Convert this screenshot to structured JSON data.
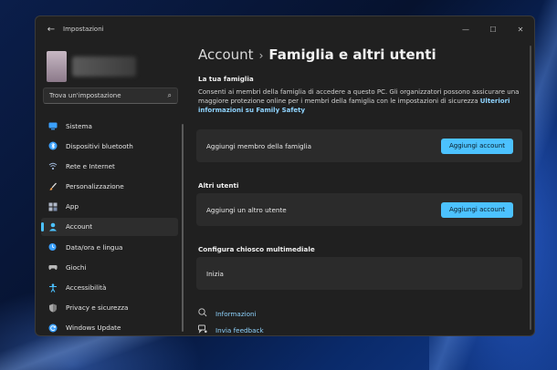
{
  "window": {
    "title": "Impostazioni"
  },
  "search": {
    "placeholder": "Trova un'impostazione"
  },
  "sidebar": {
    "items": [
      {
        "label": "Sistema",
        "icon": "monitor-icon",
        "color": "#3aa0ff"
      },
      {
        "label": "Dispositivi bluetooth",
        "icon": "bluetooth-icon",
        "color": "#3aa0ff"
      },
      {
        "label": "Rete e Internet",
        "icon": "network-icon",
        "color": "#9fb6d8"
      },
      {
        "label": "Personalizzazione",
        "icon": "brush-icon",
        "color": "#f0a050"
      },
      {
        "label": "App",
        "icon": "apps-icon",
        "color": "#b0b8c8"
      },
      {
        "label": "Account",
        "icon": "person-icon",
        "color": "#4cc2ff",
        "active": true
      },
      {
        "label": "Data/ora e lingua",
        "icon": "globe-clock-icon",
        "color": "#3aa0ff"
      },
      {
        "label": "Giochi",
        "icon": "gamepad-icon",
        "color": "#b8b8b8"
      },
      {
        "label": "Accessibilità",
        "icon": "accessibility-icon",
        "color": "#4cc2ff"
      },
      {
        "label": "Privacy e sicurezza",
        "icon": "shield-icon",
        "color": "#a8a8a8"
      },
      {
        "label": "Windows Update",
        "icon": "update-icon",
        "color": "#3aa0ff"
      }
    ]
  },
  "header": {
    "breadcrumb": "Account",
    "separator": "›",
    "current": "Famiglia e altri utenti"
  },
  "family": {
    "title": "La tua famiglia",
    "description": "Consenti ai membri della famiglia di accedere a questo PC. Gli organizzatori possono assicurare una maggiore protezione online per i membri della famiglia con le impostazioni di sicurezza",
    "link": "Ulteriori informazioni su Family Safety",
    "card_label": "Aggiungi membro della famiglia",
    "button_label": "Aggiungi account"
  },
  "others": {
    "title": "Altri utenti",
    "card_label": "Aggiungi un altro utente",
    "button_label": "Aggiungi account"
  },
  "kiosk": {
    "title": "Configura chiosco multimediale",
    "card_label": "Inizia"
  },
  "footer": {
    "info": "Informazioni",
    "feedback": "Invia feedback"
  },
  "colors": {
    "accent": "#4cc2ff",
    "window_bg": "#202020",
    "card_bg": "#2b2b2b"
  }
}
